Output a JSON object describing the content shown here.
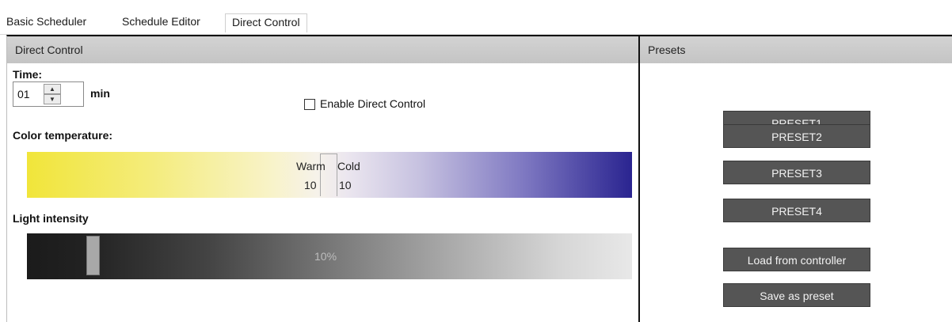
{
  "tabs": [
    {
      "label": "Basic Scheduler"
    },
    {
      "label": "Schedule Editor"
    },
    {
      "label": "Direct Control",
      "active": true
    }
  ],
  "direct_control": {
    "header": "Direct Control",
    "time_label": "Time:",
    "time_value": "01",
    "time_unit": "min",
    "enable_label": "Enable Direct Control",
    "enable_checked": false,
    "color_temp_label": "Color temperature:",
    "warm_label": "Warm",
    "warm_value": "10",
    "cold_label": "Cold",
    "cold_value": "10",
    "intensity_label": "Light intensity",
    "intensity_text": "10%",
    "intensity_fraction": 0.1
  },
  "presets": {
    "header": "Presets",
    "buttons": [
      "PRESET1",
      "PRESET2",
      "PRESET3",
      "PRESET4"
    ],
    "load_label": "Load from controller",
    "save_label": "Save as preset"
  },
  "colors": {
    "warm": "#f1e53a",
    "cold": "#2a2490",
    "button_bg": "#555555",
    "header_bg": "#c9c9c9"
  }
}
